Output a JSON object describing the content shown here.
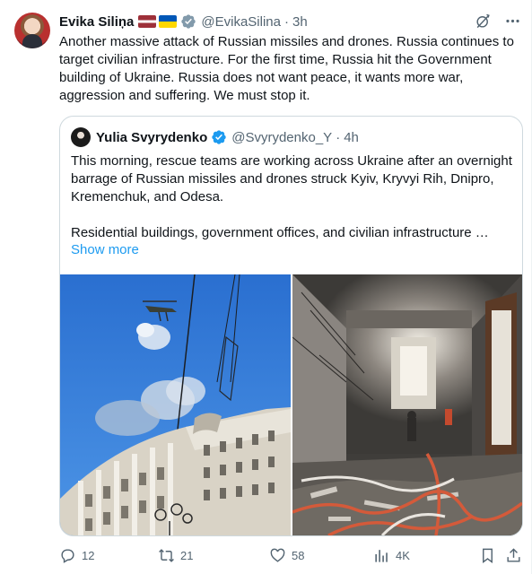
{
  "tweet": {
    "author_name": "Evika Siliņa",
    "author_handle": "@EvikaSilina",
    "time": "3h",
    "text": "Another massive attack of Russian missiles and drones. Russia continues to target civilian infrastructure. For the first time, Russia hit the Government building of Ukraine. Russia does not want peace, it wants more war, aggression and suffering. We must stop it."
  },
  "quote": {
    "author_name": "Yulia Svyrydenko",
    "author_handle": "@Svyrydenko_Y",
    "time": "4h",
    "paragraph1": "This morning, rescue teams are working across Ukraine after an overnight barrage of Russian missiles and drones struck Kyiv, Kryvyi Rih, Dnipro, Kremenchuk, and Odesa.",
    "paragraph2": "Residential buildings, government offices, and civilian infrastructure …",
    "show_more": "Show more"
  },
  "separator": "·",
  "actions": {
    "replies": "12",
    "reposts": "21",
    "likes": "58",
    "views": "4K"
  },
  "icons": [
    "verified-badge-icon",
    "grok-icon",
    "more-icon",
    "reply-icon",
    "repost-icon",
    "like-icon",
    "views-icon",
    "bookmark-icon",
    "share-icon"
  ],
  "colors": {
    "accent": "#1d9bf0",
    "secondary_text": "#536471",
    "border": "#cfd9de"
  }
}
